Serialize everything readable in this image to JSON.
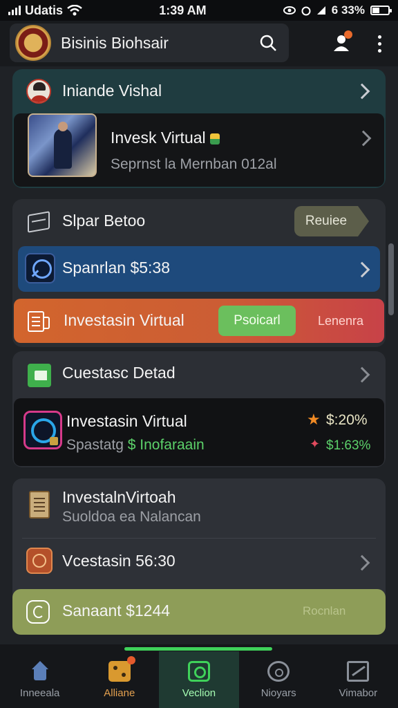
{
  "status_bar": {
    "carrier": "Udatis",
    "time": "1:39 AM",
    "battery": "6 33%"
  },
  "app_bar": {
    "title": "Bisinis Biohsair",
    "search_icon": "search-icon",
    "user_icon": "user-icon",
    "more_icon": "more-vertical-icon",
    "notification_color": "#e86a2c"
  },
  "card1": {
    "header": "Iniande Vishal",
    "item_title": "Invesk Virtual",
    "item_subtitle": "Seprnst la Mernban 012al"
  },
  "card2": {
    "header": "Slpar Betoo",
    "tag": "Reuiee",
    "row_blue": {
      "label": "Spanrlan $5:38"
    },
    "row_orange": {
      "label": "Investasin Virtual",
      "primary_button": "Psoicarl",
      "secondary_button": "Lenenra"
    }
  },
  "card3": {
    "header": "Cuestasc Detad",
    "item_title": "Investasin Virtual",
    "item_subtitle_prefix": "Spastatg",
    "item_subtitle_accent": "$ Inofaraain",
    "value_top": "$:20%",
    "value_bottom": "$1:63%",
    "accent_green": "#5cd16a"
  },
  "card4": {
    "item1_title": "InvestalnVirtoah",
    "item1_subtitle": "Suoldoa ea Nalancan",
    "item2_title": "Vcestasin 56:30",
    "olive_row": {
      "label": "Sanaant $1244",
      "action": "Rocnlan"
    }
  },
  "bottom_nav": {
    "items": [
      {
        "label": "Inneeala",
        "icon": "home-icon"
      },
      {
        "label": "Alliane",
        "icon": "dice-icon"
      },
      {
        "label": "Veclion",
        "icon": "scan-icon",
        "active": true
      },
      {
        "label": "Nioyars",
        "icon": "ring-icon"
      },
      {
        "label": "Vimabor",
        "icon": "chart-icon"
      }
    ]
  }
}
